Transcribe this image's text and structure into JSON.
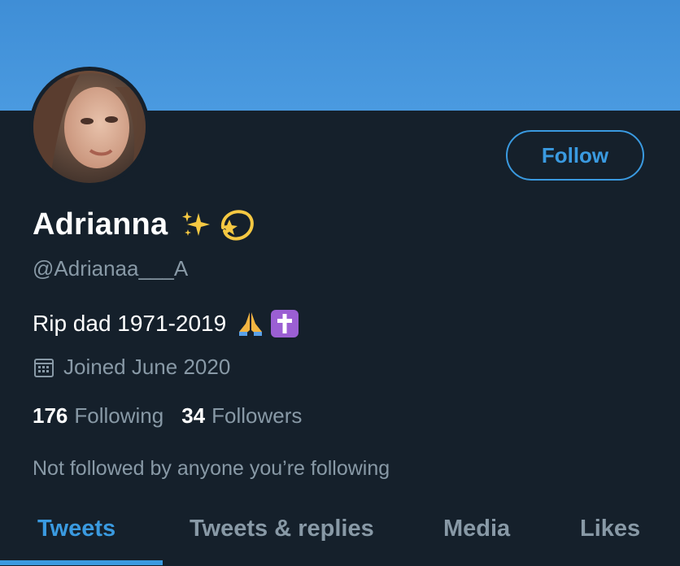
{
  "profile": {
    "display_name": "Adrianna",
    "handle": "@Adrianaa___A",
    "bio": "Rip dad 1971-2019",
    "joined": "Joined June 2020",
    "following_count": "176",
    "following_label": "Following",
    "followers_count": "34",
    "followers_label": "Followers",
    "not_followed_text": "Not followed by anyone you’re following"
  },
  "actions": {
    "follow_label": "Follow"
  },
  "tabs": [
    {
      "label": "Tweets",
      "active": true
    },
    {
      "label": "Tweets & replies",
      "active": false
    },
    {
      "label": "Media",
      "active": false
    },
    {
      "label": "Likes",
      "active": false
    }
  ],
  "icons": {
    "name_emojis": [
      "sparkles-icon",
      "dizzy-icon"
    ],
    "bio_emojis": [
      "folded-hands-icon",
      "latin-cross-icon"
    ],
    "joined_icon": "calendar-icon"
  },
  "colors": {
    "banner": "#4a9ae0",
    "background": "#15202b",
    "accent": "#3a9ae0",
    "secondary_text": "#8899a6"
  }
}
